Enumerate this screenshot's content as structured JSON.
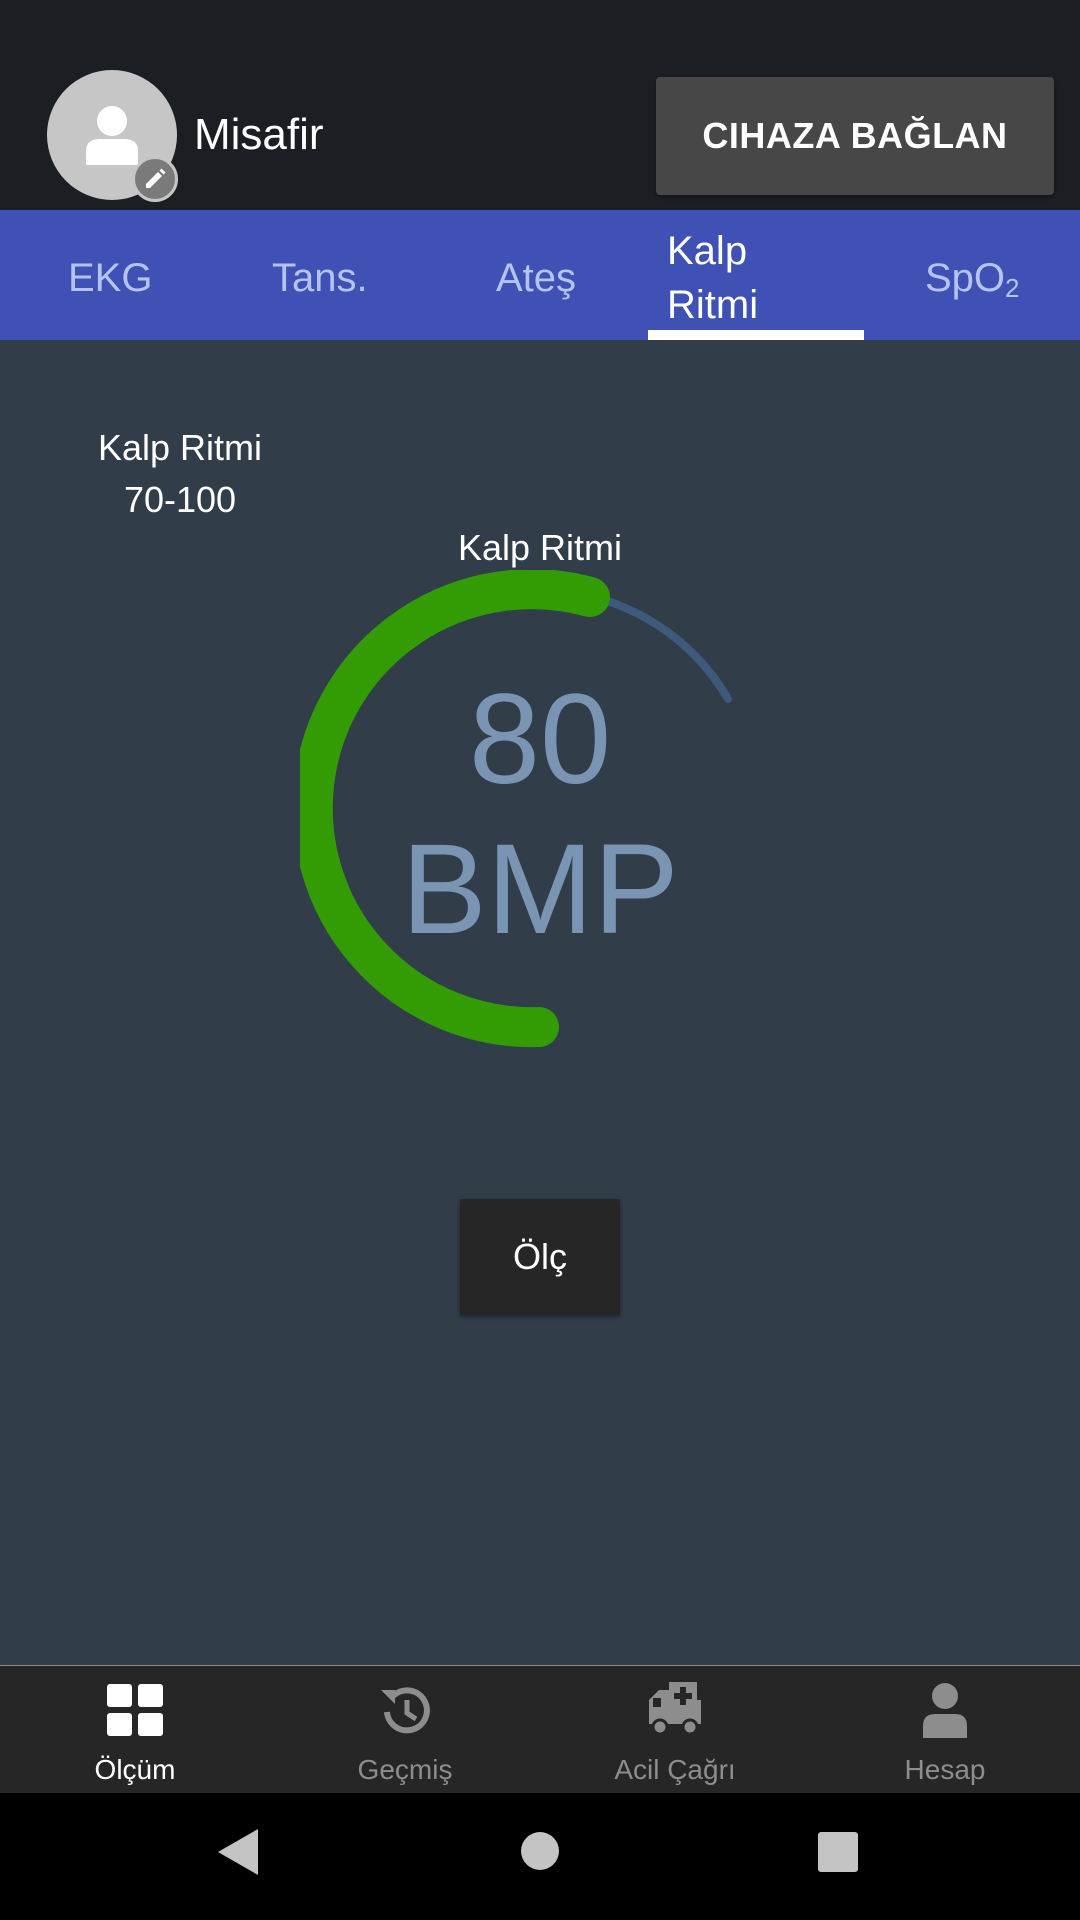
{
  "header": {
    "user_name": "Misafir",
    "connect_button": "CIHAZA BAĞLAN"
  },
  "tabs": [
    {
      "label": "EKG",
      "active": false
    },
    {
      "label": "Tans.",
      "active": false
    },
    {
      "label": "Ateş",
      "active": false
    },
    {
      "label_line1": "Kalp",
      "label_line2": "Ritmi",
      "active": true
    },
    {
      "label_main": "SpO",
      "label_sub": "2",
      "active": false
    }
  ],
  "content": {
    "range_title": "Kalp Ritmi",
    "range_value": "70-100",
    "gauge_title": "Kalp Ritmi",
    "gauge_value": "80",
    "gauge_unit": "BMP",
    "measure_button": "Ölç"
  },
  "colors": {
    "gauge_fill": "#339c04",
    "gauge_track": "#3d5a7d",
    "tab_bar": "#3f51b5"
  },
  "bottom_nav": [
    {
      "label": "Ölçüm",
      "icon": "dashboard-icon",
      "active": true
    },
    {
      "label": "Geçmiş",
      "icon": "history-icon",
      "active": false
    },
    {
      "label": "Acil Çağrı",
      "icon": "ambulance-icon",
      "active": false
    },
    {
      "label": "Hesap",
      "icon": "account-icon",
      "active": false
    }
  ],
  "system_nav": [
    "back-icon",
    "home-icon",
    "recents-icon"
  ]
}
